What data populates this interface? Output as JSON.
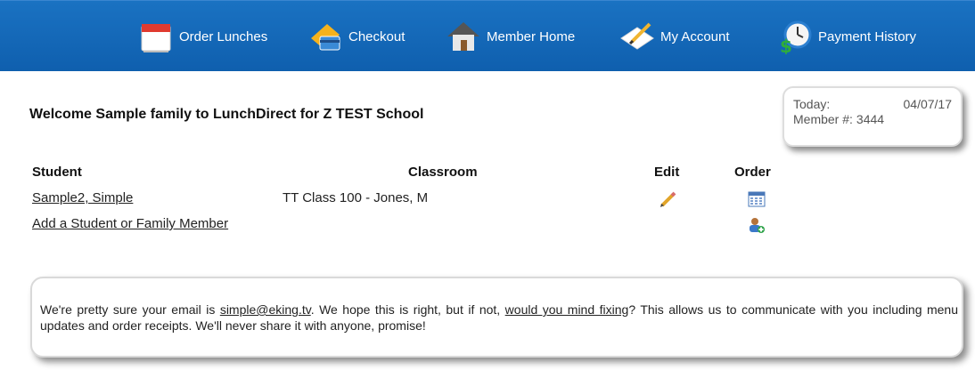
{
  "nav": {
    "items": [
      {
        "label": "Order Lunches",
        "icon": "calendar-icon"
      },
      {
        "label": "Checkout",
        "icon": "credit-card-icon"
      },
      {
        "label": "Member Home",
        "icon": "house-icon"
      },
      {
        "label": "My Account",
        "icon": "pencil-note-icon"
      },
      {
        "label": "Payment History",
        "icon": "clock-money-icon"
      }
    ]
  },
  "welcome": "Welcome Sample family to LunchDirect for Z TEST School",
  "today": {
    "today_label": "Today:",
    "date": "04/07/17",
    "member_label": "Member #:",
    "member_number": "3444"
  },
  "table": {
    "headers": {
      "student": "Student",
      "classroom": "Classroom",
      "edit": "Edit",
      "order": "Order"
    },
    "rows": [
      {
        "student": "Sample2, Simple",
        "classroom": "TT Class 100 - Jones, M"
      }
    ],
    "add_link": "Add a Student or Family Member"
  },
  "notice": {
    "part1": "We're pretty sure your email is ",
    "email": "simple@eking.tv",
    "part2": ". We hope this is right, but if not, ",
    "fix_link": "would you mind fixing",
    "part3": "? This allows us to communicate with you including menu updates and order receipts. We'll never share it with anyone, promise!"
  },
  "colors": {
    "nav_bg": "#1566b8",
    "accent": "#1a72c2"
  }
}
